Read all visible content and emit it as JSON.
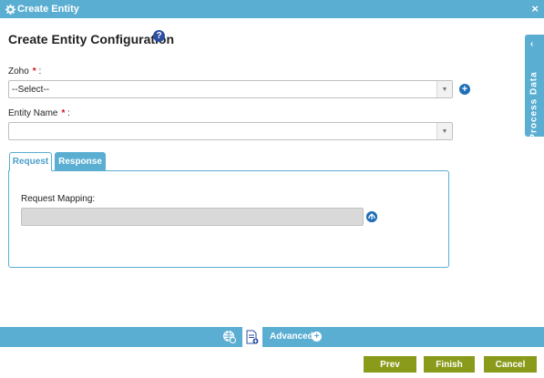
{
  "window": {
    "title": "Create Entity",
    "close_glyph": "×"
  },
  "page": {
    "heading": "Create Entity Configuration",
    "help_glyph": "?"
  },
  "form": {
    "zoho_label": "Zoho",
    "zoho_required": "*",
    "zoho_colon": ":",
    "zoho_value": "--Select--",
    "entity_label": "Entity Name",
    "entity_required": "*",
    "entity_colon": ":",
    "entity_value": ""
  },
  "tabs": [
    {
      "label": "Request",
      "active": true
    },
    {
      "label": "Response",
      "active": false
    }
  ],
  "request": {
    "mapping_label": "Request Mapping:"
  },
  "side_panel": {
    "label": "Process Data",
    "chevron": "‹"
  },
  "bottom_bar": {
    "advanced_label": "Advanced",
    "plus_glyph": "+"
  },
  "buttons": {
    "prev": "Prev",
    "finish": "Finish",
    "cancel": "Cancel"
  },
  "colors": {
    "accent": "#5aaed2",
    "button": "#8a9a1b",
    "required": "#d0141a",
    "icon_blue": "#1f6fb8"
  },
  "icons": [
    "gear-icon",
    "close-icon",
    "help-icon",
    "add-icon",
    "mapping-icon",
    "globe-settings-icon",
    "document-add-icon",
    "plus-circle-icon"
  ]
}
